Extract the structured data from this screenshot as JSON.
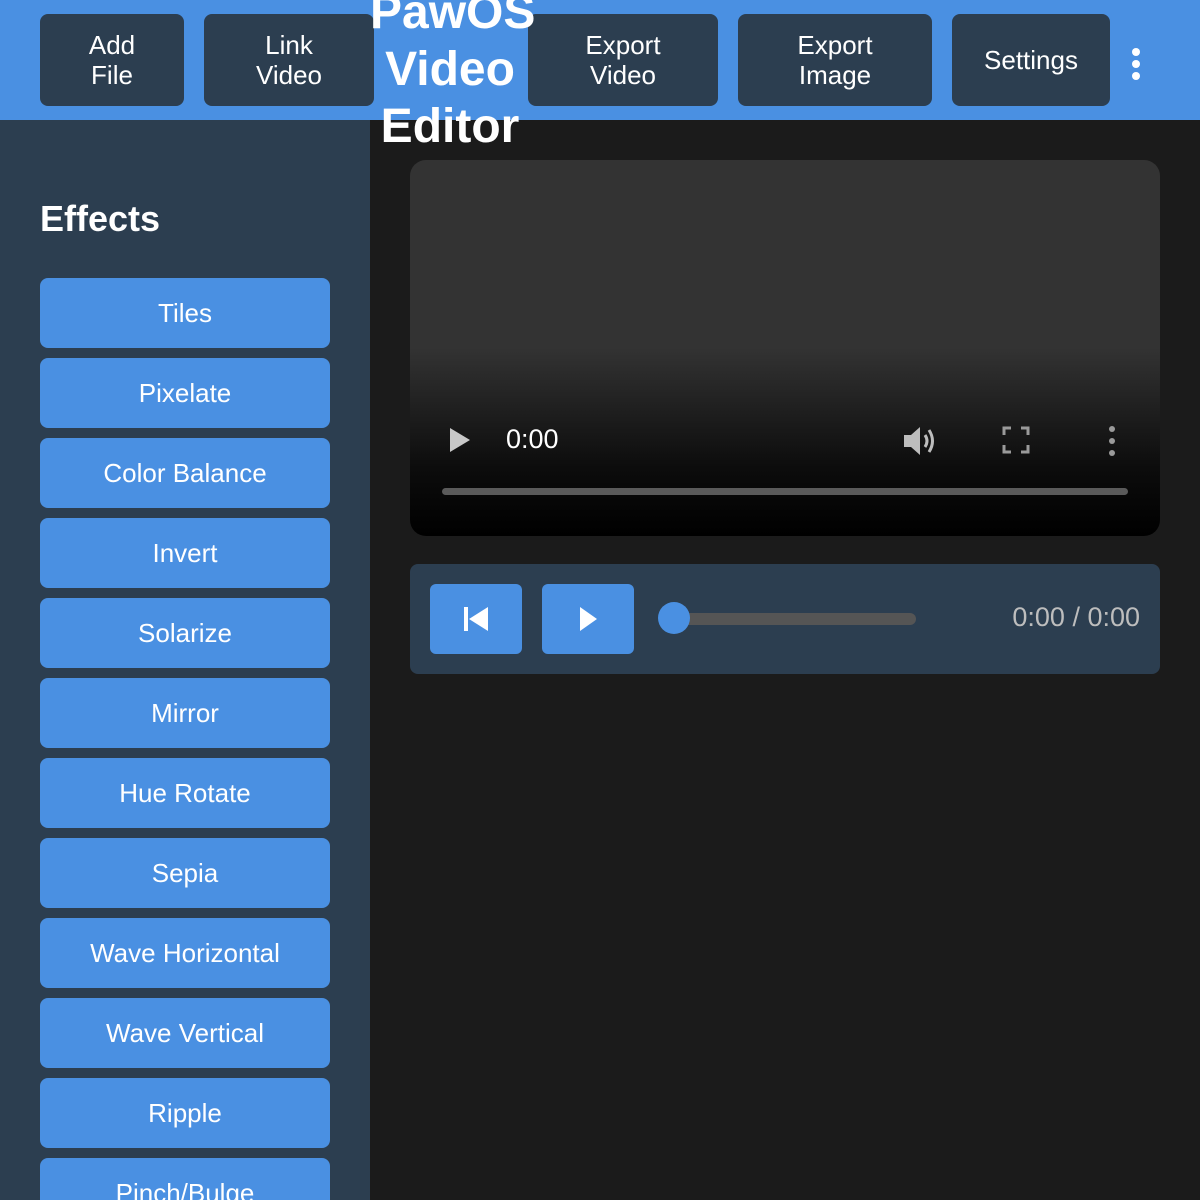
{
  "colors": {
    "accent": "#4a90e2",
    "panel": "#2c3e50",
    "background": "#1b1b1b"
  },
  "header": {
    "title": "PawOS\nVideo\nEditor",
    "buttons": {
      "add_file": "Add\nFile",
      "link_video": "Link\nVideo",
      "export_video": "Export\nVideo",
      "export_image": "Export\nImage",
      "settings": "Settings"
    },
    "more_icon": "more-vertical-icon"
  },
  "sidebar": {
    "title": "Effects",
    "effects": [
      "Tiles",
      "Pixelate",
      "Color Balance",
      "Invert",
      "Solarize",
      "Mirror",
      "Hue Rotate",
      "Sepia",
      "Wave Horizontal",
      "Wave Vertical",
      "Ripple",
      "Pinch/Bulge"
    ]
  },
  "video_player": {
    "time": "0:00",
    "icons": [
      "play-icon",
      "volume-icon",
      "fullscreen-icon",
      "more-vertical-icon"
    ],
    "progress_fraction": 0
  },
  "controls": {
    "icons": [
      "skip-back-icon",
      "play-icon"
    ],
    "seek_fraction": 0,
    "time_readout": "0:00 / 0:00"
  }
}
